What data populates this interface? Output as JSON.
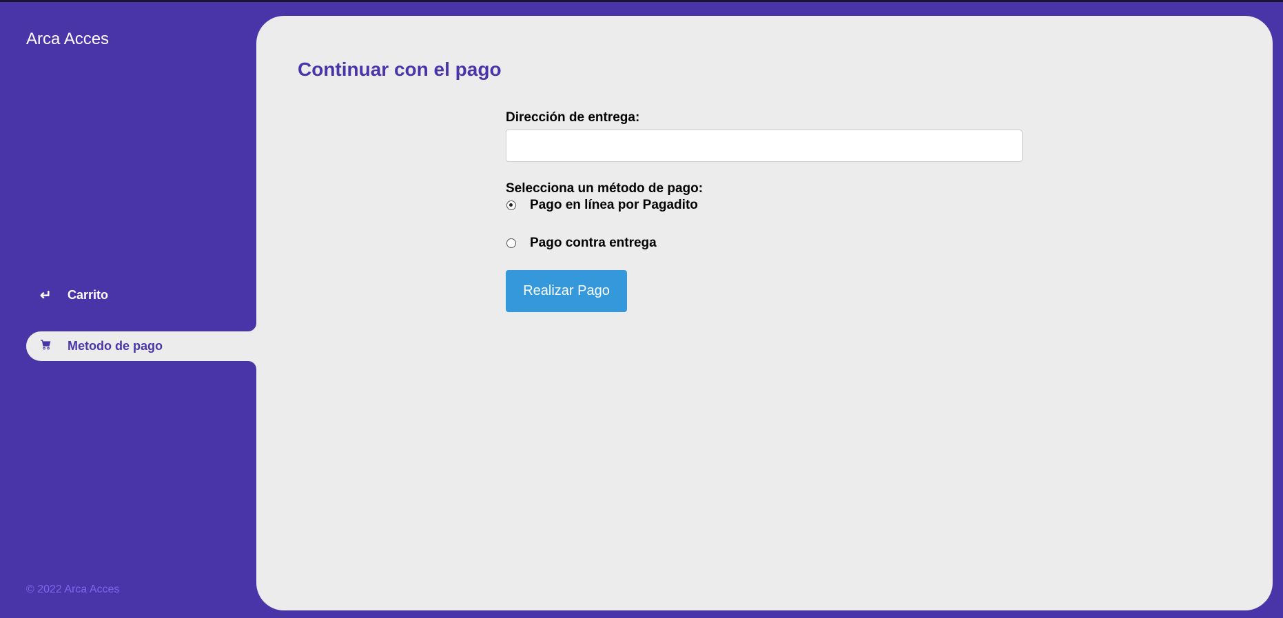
{
  "sidebar": {
    "brand": "Arca Acces",
    "items": [
      {
        "label": "Carrito",
        "icon": "return-arrow-icon",
        "glyph": "↵",
        "active": false
      },
      {
        "label": "Metodo de pago",
        "icon": "cart-icon",
        "glyph": "🛒",
        "active": true
      }
    ],
    "footer": "© 2022 Arca Acces"
  },
  "main": {
    "title": "Continuar con el pago",
    "address_label": "Dirección de entrega:",
    "address_value": "",
    "payment_label": "Selecciona un método de pago:",
    "options": [
      {
        "label": "Pago en línea por Pagadito",
        "selected": true
      },
      {
        "label": "Pago contra entrega",
        "selected": false
      }
    ],
    "submit_label": "Realizar Pago"
  },
  "colors": {
    "brand": "#4a35a8",
    "panel": "#ececec",
    "button": "#3498db",
    "footer": "#7b68ee"
  }
}
